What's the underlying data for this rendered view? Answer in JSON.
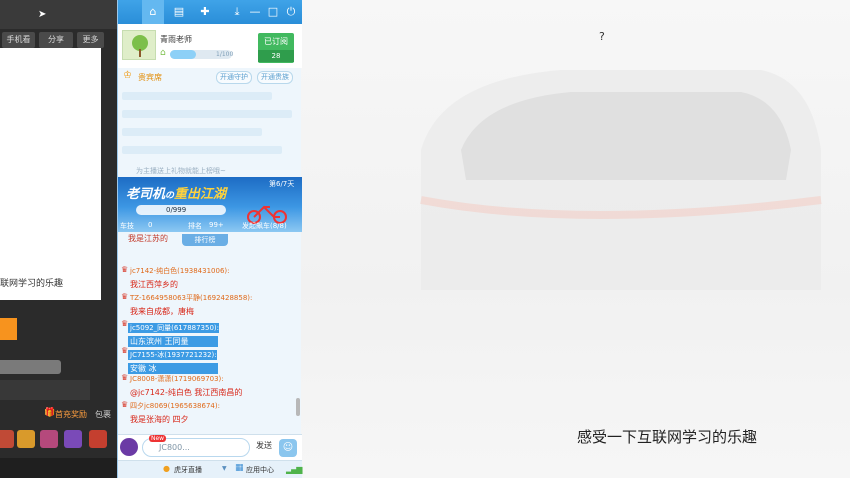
{
  "left_panel": {
    "buttons": [
      {
        "label": "手机看"
      },
      {
        "label": "分享"
      },
      {
        "label": "更多"
      }
    ],
    "video_caption": "联网学习的乐趣",
    "reward_label": "首充奖励",
    "bag_label": "包裹"
  },
  "chat_panel": {
    "anchor": {
      "name": "青雨老师",
      "level_progress": 0.42,
      "level_text": "1/100"
    },
    "subscribe": {
      "label": "已订阅",
      "count": "28"
    },
    "fans": {
      "label": "贵宾席",
      "guard_button": "开通守护",
      "noble_button": "开通贵族"
    },
    "faded_notice": "为主播送上礼物就能上榜哦~",
    "banner": {
      "title_part1": "老司机",
      "title_part2": "の",
      "title_part3": "重出江湖",
      "period": "第6/7天",
      "progress": "0/999",
      "seat_label": "车技",
      "seat_value": "0",
      "rank_label": "排名",
      "rank_value": "99+",
      "launch_label": "发起飙车(8/8)"
    },
    "rank_tab": "排行榜",
    "cut_message": "我是江苏的",
    "messages": [
      {
        "user": "jc7142-纯白色(1938431006):",
        "text": "我江西萍乡的",
        "highlight": false
      },
      {
        "user": "TZ-1664958063平静(1692428858):",
        "text": "我来自成都，唐梅",
        "highlight": false
      },
      {
        "user": "jc5092_同量(617887350):",
        "text": "山东滨州 王同量",
        "highlight": true
      },
      {
        "user": "JC7155-冰(1937721232):",
        "text": "安徽 冰",
        "highlight": true
      },
      {
        "user": "JC8008-潇潇(1719069703):",
        "text": "@jc7142-纯白色 我江西南昌的",
        "highlight": false
      },
      {
        "user": "四夕jc8069(1965638674):",
        "text": "我是张海的 四夕",
        "highlight": false
      }
    ],
    "input": {
      "badge": "New",
      "value": "JC800..."
    },
    "send_label": "发送",
    "status_bar": {
      "brand": "虎牙直播",
      "app_center": "应用中心"
    }
  },
  "video": {
    "subtitle": "感受一下互联网学习的乐趣",
    "stray_char": "?"
  }
}
